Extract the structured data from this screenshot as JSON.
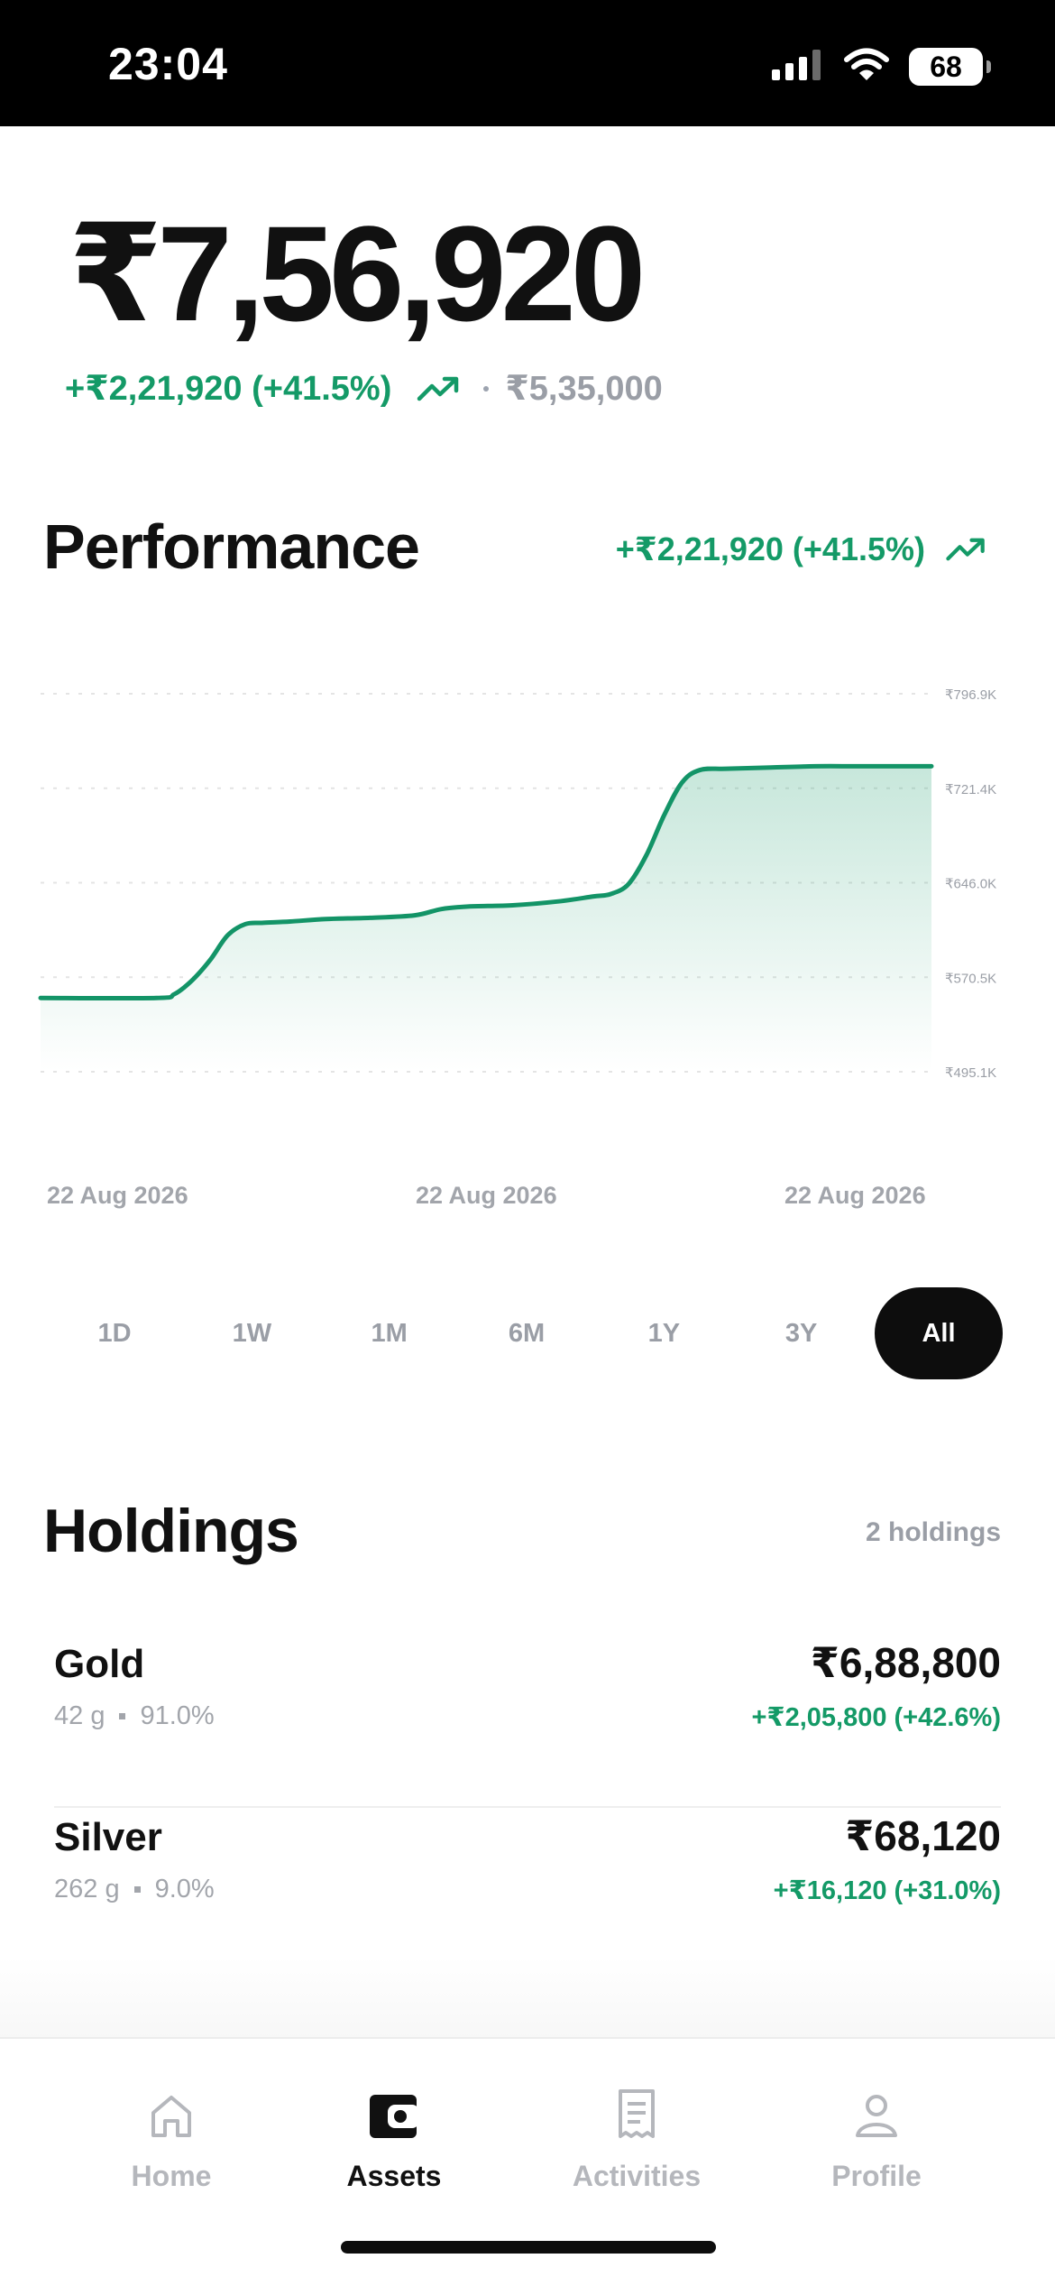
{
  "status_bar": {
    "time": "23:04",
    "battery": "68",
    "icons": [
      "cellular-signal-icon",
      "wifi-icon",
      "battery-icon"
    ]
  },
  "portfolio": {
    "total_value": "₹7,56,920",
    "gain": "+₹2,21,920 (+41.5%)",
    "invested": "₹5,35,000"
  },
  "performance": {
    "title": "Performance",
    "gain": "+₹2,21,920 (+41.5%)"
  },
  "chart_data": {
    "type": "area",
    "x_tick_labels": [
      "22 Aug 2026",
      "22 Aug 2026",
      "22 Aug 2026"
    ],
    "y_tick_labels": [
      "₹796.9K",
      "₹721.4K",
      "₹646.0K",
      "₹570.5K",
      "₹495.1K"
    ],
    "ylim": [
      495.1,
      796.9
    ],
    "grid": true,
    "points": [
      [
        0,
        554
      ],
      [
        13,
        554
      ],
      [
        15,
        557
      ],
      [
        17,
        568
      ],
      [
        19,
        584
      ],
      [
        21,
        604
      ],
      [
        23,
        613
      ],
      [
        25,
        614
      ],
      [
        28,
        615
      ],
      [
        32,
        617
      ],
      [
        37,
        618
      ],
      [
        42,
        620
      ],
      [
        45,
        625
      ],
      [
        48,
        627
      ],
      [
        53,
        628
      ],
      [
        58,
        631
      ],
      [
        62,
        635
      ],
      [
        64,
        637
      ],
      [
        66,
        645
      ],
      [
        68,
        668
      ],
      [
        70,
        700
      ],
      [
        72,
        726
      ],
      [
        74,
        736
      ],
      [
        77,
        737
      ],
      [
        82,
        738
      ],
      [
        87,
        739
      ],
      [
        92,
        739
      ],
      [
        100,
        739
      ]
    ],
    "line_color": "#139467",
    "fill_color": "#1f9e6e"
  },
  "ranges": {
    "options": [
      "1D",
      "1W",
      "1M",
      "6M",
      "1Y",
      "3Y",
      "All"
    ],
    "selected": "All"
  },
  "holdings": {
    "title": "Holdings",
    "count": "2 holdings",
    "items": [
      {
        "name": "Gold",
        "quantity": "42 g",
        "allocation": "91.0%",
        "value": "₹6,88,800",
        "gain": "+₹2,05,800 (+42.6%)"
      },
      {
        "name": "Silver",
        "quantity": "262 g",
        "allocation": "9.0%",
        "value": "₹68,120",
        "gain": "+₹16,120 (+31.0%)"
      }
    ]
  },
  "nav": {
    "items": [
      {
        "label": "Home",
        "icon": "home-icon"
      },
      {
        "label": "Assets",
        "icon": "wallet-icon"
      },
      {
        "label": "Activities",
        "icon": "receipt-icon"
      },
      {
        "label": "Profile",
        "icon": "user-icon"
      }
    ],
    "active": "Assets"
  },
  "colors": {
    "accent_green": "#149a67",
    "muted_text": "#9a9ea6",
    "active_tab": "#0d0d0d"
  }
}
